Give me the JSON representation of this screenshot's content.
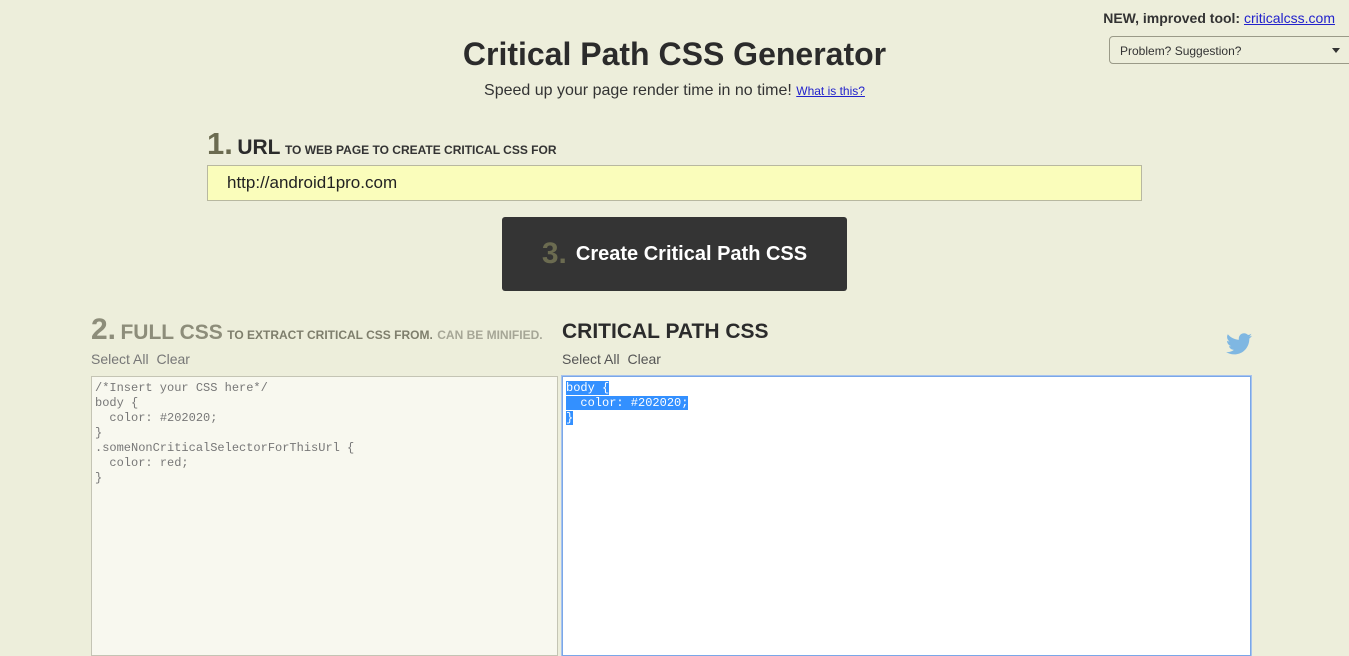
{
  "top_right": {
    "label": "NEW, improved tool:",
    "link": "criticalcss.com"
  },
  "feedback": {
    "selected": "Problem? Suggestion?"
  },
  "header": {
    "title": "Critical Path CSS Generator",
    "subtitle": "Speed up your page render time in no time!",
    "what_link": "What is this?"
  },
  "url_section": {
    "number": "1.",
    "label": "URL",
    "description": "TO WEB PAGE TO CREATE CRITICAL CSS FOR",
    "value": "http://android1pro.com"
  },
  "create_button": {
    "number": "3.",
    "label": "Create Critical Path CSS"
  },
  "full_css": {
    "number": "2.",
    "label": "FULL CSS",
    "description": "TO EXTRACT CRITICAL CSS FROM.",
    "note": "CAN BE MINIFIED.",
    "select_all": "Select All",
    "clear": "Clear",
    "value": "/*Insert your CSS here*/\nbody {\n  color: #202020;\n}\n.someNonCriticalSelectorForThisUrl {\n  color: red;\n}"
  },
  "critical_css": {
    "label": "CRITICAL PATH CSS",
    "select_all": "Select All",
    "clear": "Clear",
    "lines": [
      "body {",
      "  color: #202020;",
      "}"
    ]
  },
  "icons": {
    "share": "twitter-icon"
  },
  "colors": {
    "background": "#edeedb",
    "url_input": "#fafdbb",
    "button": "#343434",
    "step_number": "#6b6b50",
    "selection": "#3390ff",
    "twitter": "#7fb7e2"
  }
}
